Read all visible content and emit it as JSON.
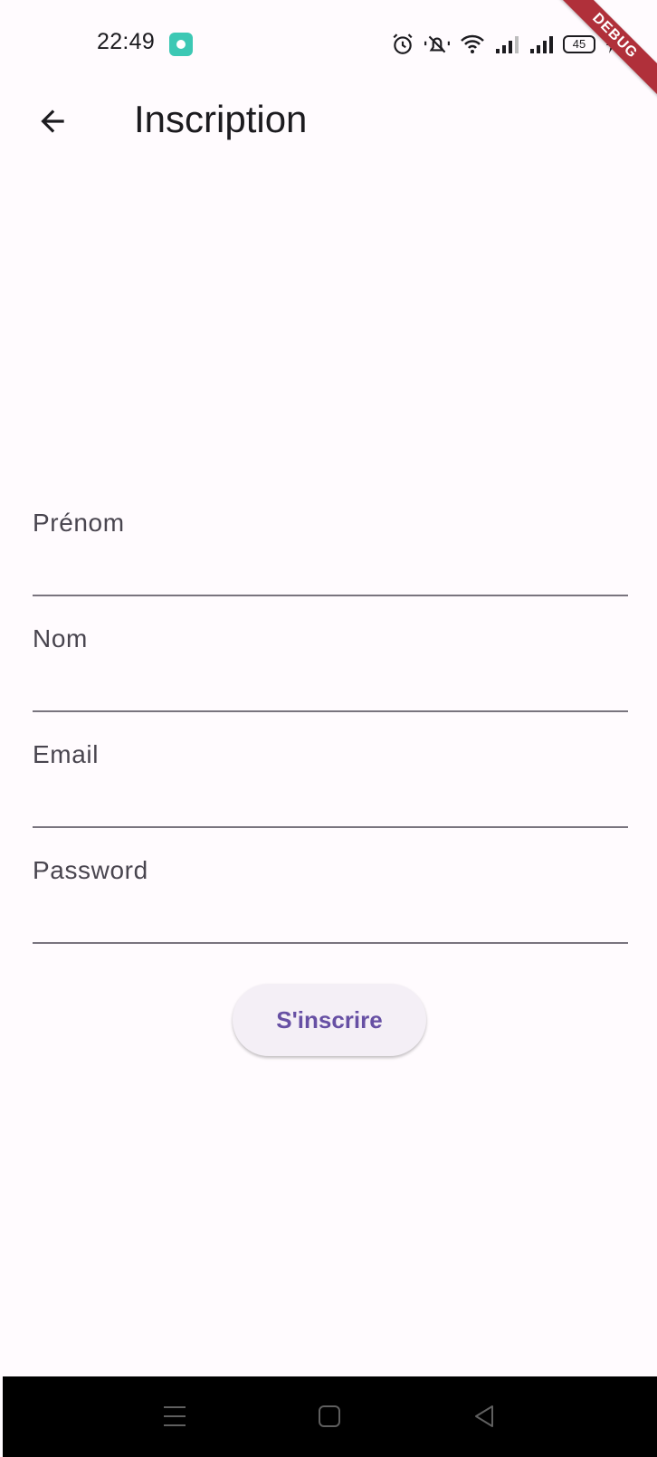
{
  "status_bar": {
    "time": "22:49",
    "battery_level": "45",
    "debug_label": "DEBUG",
    "icons": [
      "app-notification-icon",
      "alarm-icon",
      "bell-muted-icon",
      "wifi-icon",
      "signal-icon",
      "signal-icon",
      "battery-icon",
      "charging-bolt-icon"
    ]
  },
  "app_bar": {
    "title": "Inscription",
    "back_icon": "arrow-back-icon"
  },
  "form": {
    "fields": [
      {
        "label": "Prénom",
        "value": ""
      },
      {
        "label": "Nom",
        "value": ""
      },
      {
        "label": "Email",
        "value": ""
      },
      {
        "label": "Password",
        "value": ""
      }
    ],
    "submit_label": "S'inscrire"
  },
  "nav_bar": {
    "icons": [
      "menu-icon",
      "home-icon",
      "back-triangle-icon"
    ]
  },
  "colors": {
    "background": "#fffbfe",
    "primary": "#6750a4",
    "button_bg": "#f4eff6",
    "text": "#1c1b1f",
    "label": "#49454f",
    "underline": "#79747e",
    "debug_ribbon": "#b0303a",
    "nav_bar": "#000000"
  }
}
